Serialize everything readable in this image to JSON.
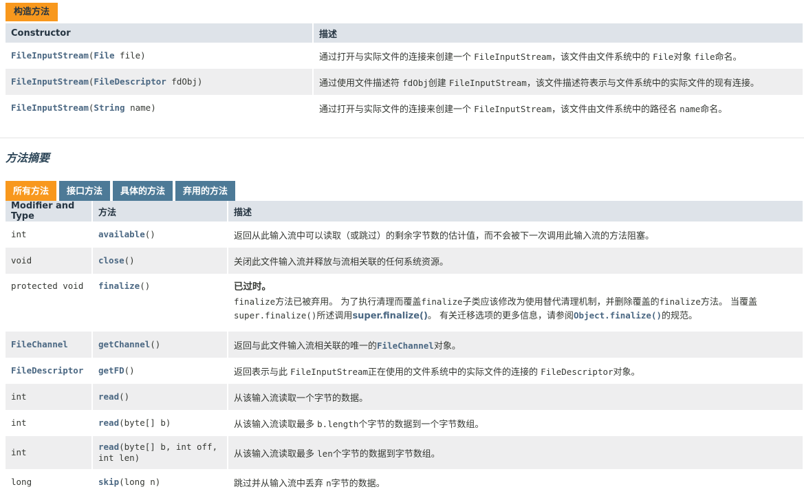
{
  "constructor_section": {
    "tab_label": "构造方法",
    "col_constructor": "Constructor",
    "col_desc": "描述",
    "rows": [
      {
        "name": "FileInputStream",
        "open": "(",
        "ptype": "File",
        "pname": " file)",
        "desc": [
          {
            "t": "通过打开与实际文件的连接来创建一个 ",
            "m": false
          },
          {
            "t": "FileInputStream",
            "m": true
          },
          {
            "t": "，该文件由文件系统中的 ",
            "m": false
          },
          {
            "t": "File",
            "m": true
          },
          {
            "t": "对象 ",
            "m": false
          },
          {
            "t": "file",
            "m": true
          },
          {
            "t": "命名。",
            "m": false
          }
        ]
      },
      {
        "name": "FileInputStream",
        "open": "(",
        "ptype": "FileDescriptor",
        "pname": " fdObj)",
        "desc": [
          {
            "t": "通过使用文件描述符 ",
            "m": false
          },
          {
            "t": "fdObj",
            "m": true
          },
          {
            "t": "创建 ",
            "m": false
          },
          {
            "t": "FileInputStream",
            "m": true
          },
          {
            "t": "，该文件描述符表示与文件系统中的实际文件的现有连接。",
            "m": false
          }
        ]
      },
      {
        "name": "FileInputStream",
        "open": "(",
        "ptype": "String",
        "pname": " name)",
        "desc": [
          {
            "t": "通过打开与实际文件的连接来创建一个 ",
            "m": false
          },
          {
            "t": "FileInputStream",
            "m": true
          },
          {
            "t": "，该文件由文件系统中的路径名 ",
            "m": false
          },
          {
            "t": "name",
            "m": true
          },
          {
            "t": "命名。",
            "m": false
          }
        ]
      }
    ]
  },
  "method_summary": {
    "heading": "方法摘要",
    "tabs": [
      "所有方法",
      "接口方法",
      "具体的方法",
      "弃用的方法"
    ],
    "col_modifier": "Modifier and Type",
    "col_method": "方法",
    "col_desc": "描述",
    "rows": [
      {
        "mod": "int",
        "mod_link": false,
        "method": "available",
        "params": "()",
        "desc": [
          {
            "t": "返回从此输入流中可以读取（或跳过）的剩余字节数的估计值，而不会被下一次调用此输入流的方法阻塞。",
            "m": false
          }
        ]
      },
      {
        "mod": "void",
        "mod_link": false,
        "method": "close",
        "params": "()",
        "desc": [
          {
            "t": "关闭此文件输入流并释放与流相关联的任何系统资源。",
            "m": false
          }
        ]
      },
      {
        "mod": "protected void",
        "mod_link": false,
        "method": "finalize",
        "params": "()",
        "deprecated": "已过时。",
        "desc_line1": [
          {
            "t": "finalize",
            "m": true
          },
          {
            "t": "方法已被弃用。 为了执行清理而覆盖",
            "m": false
          },
          {
            "t": "finalize",
            "m": true
          },
          {
            "t": "子类应该修改为使用替代清理机制，并删除覆盖的",
            "m": false
          },
          {
            "t": "finalize",
            "m": true
          },
          {
            "t": "方法。 当覆盖",
            "m": false
          }
        ],
        "desc_line2": [
          {
            "t": "super.finalize()",
            "m": true
          },
          {
            "t": "所述调用",
            "m": false
          },
          {
            "t": "super.finalize()",
            "m": false,
            "b": true
          },
          {
            "t": "。 有关迁移选项的更多信息，请参阅",
            "m": false
          },
          {
            "t": "Object.finalize()",
            "m": true,
            "l": true
          },
          {
            "t": "的规范。",
            "m": false
          }
        ]
      },
      {
        "mod": "FileChannel",
        "mod_link": true,
        "method": "getChannel",
        "params": "()",
        "desc": [
          {
            "t": "返回与此文件输入流相关联的唯一的",
            "m": false
          },
          {
            "t": "FileChannel",
            "m": true,
            "l": true
          },
          {
            "t": "对象。",
            "m": false
          }
        ]
      },
      {
        "mod": "FileDescriptor",
        "mod_link": true,
        "method": "getFD",
        "params": "()",
        "desc": [
          {
            "t": "返回表示与此 ",
            "m": false
          },
          {
            "t": "FileInputStream",
            "m": true
          },
          {
            "t": "正在使用的文件系统中的实际文件的连接的 ",
            "m": false
          },
          {
            "t": "FileDescriptor",
            "m": true
          },
          {
            "t": "对象。",
            "m": false
          }
        ]
      },
      {
        "mod": "int",
        "mod_link": false,
        "method": "read",
        "params": "()",
        "desc": [
          {
            "t": "从该输入流读取一个字节的数据。",
            "m": false
          }
        ]
      },
      {
        "mod": "int",
        "mod_link": false,
        "method": "read",
        "params": "(byte[] b)",
        "desc": [
          {
            "t": "从该输入流读取最多 ",
            "m": false
          },
          {
            "t": "b.length",
            "m": true
          },
          {
            "t": "个字节的数据到一个字节数组。",
            "m": false
          }
        ]
      },
      {
        "mod": "int",
        "mod_link": false,
        "method": "read",
        "params": "(byte[] b, int off,",
        "params2": "int len)",
        "desc": [
          {
            "t": "从该输入流读取最多 ",
            "m": false
          },
          {
            "t": "len",
            "m": true
          },
          {
            "t": "个字节的数据到字节数组。",
            "m": false
          }
        ]
      },
      {
        "mod": "long",
        "mod_link": false,
        "method": "skip",
        "params": "(long n)",
        "desc": [
          {
            "t": "跳过并从输入流中丢弃 ",
            "m": false
          },
          {
            "t": "n",
            "m": true
          },
          {
            "t": "字节的数据。",
            "m": false
          }
        ]
      }
    ]
  }
}
